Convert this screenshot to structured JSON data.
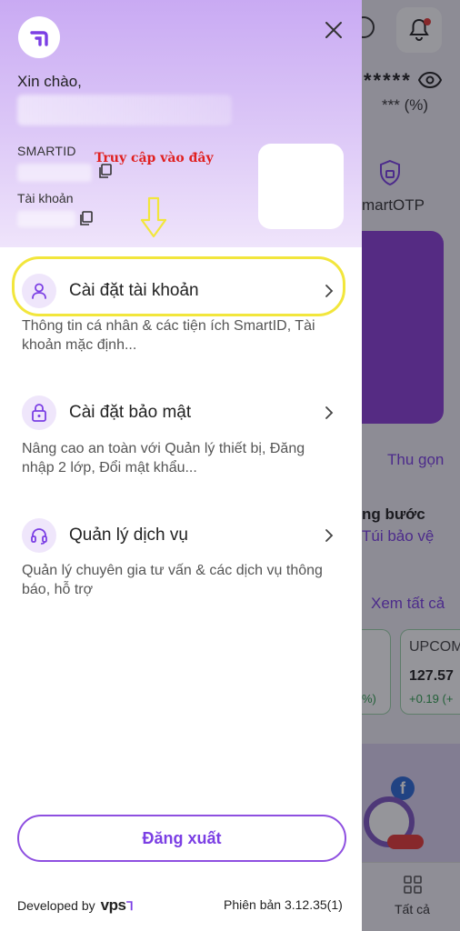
{
  "background": {
    "stars": "*****",
    "percent": "*** (%)",
    "smartotp_label": "martOTP",
    "collapse_label": "Thu gọn",
    "step_heading": "ng bước",
    "protect_link": "Túi bảo vệ",
    "view_all": "Xem tất cả",
    "tile_change_partial": "%)",
    "index_tile": {
      "name": "UPCOM",
      "value": "127.57",
      "change": "+0.19 (+"
    },
    "tab_all_label": "Tất cả"
  },
  "drawer": {
    "greeting": "Xin chào,",
    "smartid_label": "SMARTID",
    "account_label": "Tài khoản",
    "annotation_text": "Truy cập vào đây",
    "menu": [
      {
        "icon": "user-icon",
        "label": "Cài đặt tài khoản",
        "description": "Thông tin cá nhân & các tiện ích SmartID, Tài khoản mặc định..."
      },
      {
        "icon": "lock-icon",
        "label": "Cài đặt bảo mật",
        "description": "Nâng cao an toàn với Quản lý thiết bị, Đăng nhập 2 lớp, Đổi mật khẩu..."
      },
      {
        "icon": "headset-icon",
        "label": "Quản lý dịch vụ",
        "description": "Quản lý chuyên gia tư vấn & các dịch vụ thông báo, hỗ trợ"
      }
    ],
    "logout_label": "Đăng xuất",
    "developed_by": "Developed by",
    "developer_brand": "vps",
    "version": "Phiên bản 3.12.35(1)"
  },
  "colors": {
    "accent": "#7b3fe4",
    "header_gradient_top": "#c9aaf3",
    "highlight_yellow": "#f2e63c",
    "annotation_red": "#e02020"
  }
}
